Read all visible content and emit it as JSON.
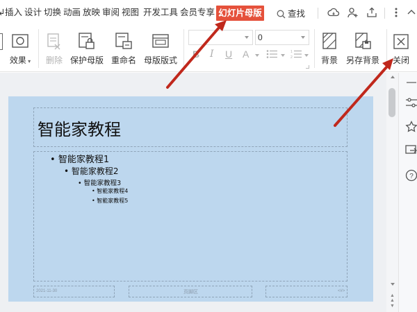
{
  "menu": {
    "items": [
      "插入",
      "设计",
      "切换",
      "动画",
      "放映",
      "审阅",
      "视图",
      "开发工具",
      "会员专享"
    ],
    "active_tab": "幻灯片母版",
    "search_label": "查找"
  },
  "ribbon": {
    "effects_label": "效果",
    "delete_label": "删除",
    "protect_master_label": "保护母版",
    "rename_label": "重命名",
    "master_layout_label": "母版版式",
    "font_name_value": "",
    "font_size_value": "0",
    "background_label": "背景",
    "save_background_label": "另存背景",
    "close_label": "关闭"
  },
  "slide": {
    "title": "智能家教程",
    "bullets": [
      "智能家教程1",
      "智能家教程2",
      "智能家教程3",
      "智能家教程4",
      "智能家教程5"
    ],
    "footer_date": "2021-11-30",
    "footer_center": "页脚区",
    "footer_page": "<#>"
  },
  "colors": {
    "accent": "#e5513b",
    "slide_background": "#bdd7ee",
    "annotation_arrow": "#c0281c"
  }
}
